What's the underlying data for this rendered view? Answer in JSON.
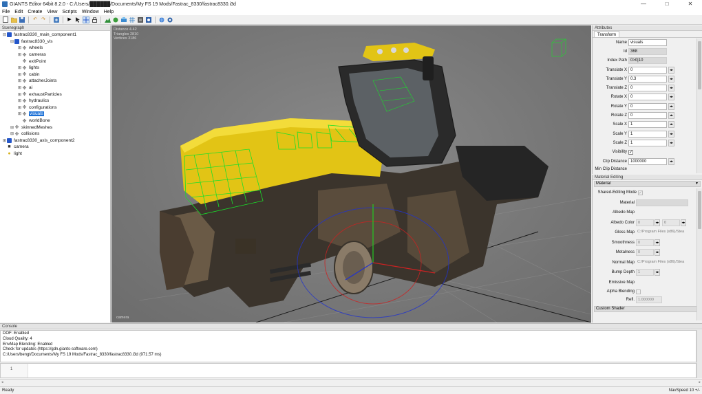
{
  "window": {
    "title": "GIANTS Editor 64bit 8.2.0 - C:/Users/██████/Documents/My FS 19 Mods/Fastrac_8330/fastrac8330.i3d",
    "minimize_glyph": "—",
    "maximize_glyph": "□",
    "close_glyph": "✕"
  },
  "menu": [
    "File",
    "Edit",
    "Create",
    "View",
    "Scripts",
    "Window",
    "Help"
  ],
  "toolbar_icons": [
    "new-file-icon",
    "open-folder-icon",
    "save-icon",
    "undo-icon",
    "redo-icon",
    "import-icon",
    "play-icon",
    "select-icon",
    "move-icon",
    "lock-icon",
    "terrain-icon",
    "foliage-icon",
    "paint-icon",
    "grid-icon",
    "bone-icon",
    "settings-icon",
    "globe-icon",
    "record-icon"
  ],
  "scenegraph": {
    "title": "Scenegraph",
    "nodes": [
      {
        "label": "fastrac8330_main_component1",
        "depth": 0,
        "exp": "⊟",
        "icon": "cube"
      },
      {
        "label": "fastrac8330_vis",
        "depth": 1,
        "exp": "⊟",
        "icon": "cube"
      },
      {
        "label": "wheels",
        "depth": 2,
        "exp": "⊞",
        "icon": "grp"
      },
      {
        "label": "cameras",
        "depth": 2,
        "exp": "⊞",
        "icon": "grp"
      },
      {
        "label": "exitPoint",
        "depth": 2,
        "exp": "",
        "icon": "grp"
      },
      {
        "label": "lights",
        "depth": 2,
        "exp": "⊞",
        "icon": "grp"
      },
      {
        "label": "cabin",
        "depth": 2,
        "exp": "⊞",
        "icon": "grp"
      },
      {
        "label": "attacherJoints",
        "depth": 2,
        "exp": "⊞",
        "icon": "grp"
      },
      {
        "label": "ai",
        "depth": 2,
        "exp": "⊞",
        "icon": "grp"
      },
      {
        "label": "exhaustParticles",
        "depth": 2,
        "exp": "⊞",
        "icon": "grp"
      },
      {
        "label": "hydraulics",
        "depth": 2,
        "exp": "⊞",
        "icon": "grp"
      },
      {
        "label": "configurations",
        "depth": 2,
        "exp": "⊞",
        "icon": "grp"
      },
      {
        "label": "visuals",
        "depth": 2,
        "exp": "⊞",
        "icon": "grp",
        "selected": true
      },
      {
        "label": "worldBone",
        "depth": 2,
        "exp": "",
        "icon": "grp"
      },
      {
        "label": "skinnedMeshes",
        "depth": 1,
        "exp": "⊞",
        "icon": "grp"
      },
      {
        "label": "collisions",
        "depth": 1,
        "exp": "⊞",
        "icon": "grp"
      },
      {
        "label": "fastrac8330_axis_component2",
        "depth": 0,
        "exp": "⊞",
        "icon": "cube"
      },
      {
        "label": "camera",
        "depth": 0,
        "exp": "",
        "icon": "cam"
      },
      {
        "label": "light",
        "depth": 0,
        "exp": "",
        "icon": "light"
      }
    ]
  },
  "viewport": {
    "stats": [
      "Distance 4.42",
      "Triangles 2810",
      "Vertices 3186"
    ],
    "camera_label": "camera"
  },
  "attributes": {
    "title": "Attributes",
    "tab": "Transform",
    "fields": [
      {
        "label": "Name",
        "value": "visuals",
        "readonly": false,
        "spin": false
      },
      {
        "label": "Id",
        "value": "368",
        "readonly": true,
        "spin": false
      },
      {
        "label": "Index Path",
        "value": "0>0|10",
        "readonly": true,
        "spin": false
      },
      {
        "label": "Translate X",
        "value": "0",
        "readonly": false,
        "spin": true
      },
      {
        "label": "Translate Y",
        "value": "0.3",
        "readonly": false,
        "spin": true
      },
      {
        "label": "Translate Z",
        "value": "0",
        "readonly": false,
        "spin": true
      },
      {
        "label": "Rotate X",
        "value": "0",
        "readonly": false,
        "spin": true
      },
      {
        "label": "Rotate Y",
        "value": "0",
        "readonly": false,
        "spin": true
      },
      {
        "label": "Rotate Z",
        "value": "0",
        "readonly": false,
        "spin": true
      },
      {
        "label": "Scale X",
        "value": "1",
        "readonly": false,
        "spin": true
      },
      {
        "label": "Scale Y",
        "value": "1",
        "readonly": false,
        "spin": true
      },
      {
        "label": "Scale Z",
        "value": "1",
        "readonly": false,
        "spin": true
      }
    ],
    "visibility_label": "Visibility",
    "visibility_checked": "✓",
    "clip_label": "Clip Distance",
    "clip_value": "1000000",
    "minclip_label": "Min Clip Distance",
    "spin_glyph": "◂▸"
  },
  "material": {
    "title": "Material Editing",
    "section": "Material",
    "section_arrow": "▼",
    "shared_label": "Shared-Editing Mode",
    "shared_check": "✓",
    "rows": {
      "material": "Material",
      "albedo_map": "Albedo Map",
      "albedo_color": "Albedo Color",
      "albedo_r": "0",
      "albedo_g": "0",
      "gloss_map": "Gloss Map",
      "gloss_path": "C:/Program Files (x86)/Stea",
      "smoothness": "Smoothness",
      "smoothness_val": "0",
      "metalness": "Metalness",
      "metalness_val": "0",
      "normal_map": "Normal Map",
      "normal_path": "C:/Program Files (x86)/Stea",
      "bump_depth": "Bump Depth",
      "bump_val": "1",
      "emissive_map": "Emissive Map",
      "alpha_blending": "Alpha Blending",
      "refl": "Refl.",
      "refl_val": "1.000000"
    },
    "custom_shader": "Custom Shader",
    "file_glyph": "…"
  },
  "console": {
    "title": "Console",
    "lines": [
      "DOF: Enabled",
      "Cloud Quality: 4",
      "EnvMap Blending: Enabled",
      "Check for updates (https://gdn.giants-software.com)",
      "C:/Users/bengt/Documents/My FS 19 Mods/Fastrac_8330/fastrac8330.i3d (971.57 ms)"
    ],
    "input_line_number": "1"
  },
  "hscroll": {
    "left": "◂",
    "right": "▸"
  },
  "status": {
    "left": "Ready",
    "right": "NavSpeed 10 +/-"
  }
}
